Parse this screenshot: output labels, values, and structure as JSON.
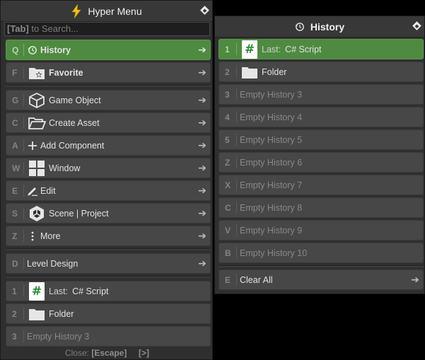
{
  "main_panel": {
    "title": "Hyper Menu",
    "search_placeholder_key": "[Tab]",
    "search_placeholder_text": " to Search...",
    "items": [
      {
        "key": "Q",
        "label": "History",
        "arrow": "➔"
      },
      {
        "key": "F",
        "label": "Favorite",
        "arrow": "➔"
      },
      {
        "key": "G",
        "label": "Game Object",
        "arrow": "➔"
      },
      {
        "key": "C",
        "label": "Create Asset",
        "arrow": "➔"
      },
      {
        "key": "A",
        "label": "Add Component",
        "arrow": "➔"
      },
      {
        "key": "W",
        "label": "Window",
        "arrow": "➔"
      },
      {
        "key": "E",
        "label": "Edit",
        "arrow": "➔"
      },
      {
        "key": "S",
        "label": "Scene | Project",
        "arrow": "➔"
      },
      {
        "key": "Z",
        "label": "More",
        "arrow": "➔"
      },
      {
        "key": "D",
        "label": "Level Design",
        "arrow": "➔"
      },
      {
        "key": "1",
        "prefix": "Last:",
        "label": "C# Script"
      },
      {
        "key": "2",
        "label": "Folder"
      },
      {
        "key": "3",
        "label": "Empty History 3"
      }
    ],
    "close_label": "Close:",
    "close_key": "[Escape]",
    "more_key": "[>]"
  },
  "history_panel": {
    "title": "History",
    "items": [
      {
        "key": "1",
        "prefix": "Last:",
        "label": "C# Script"
      },
      {
        "key": "2",
        "label": "Folder"
      },
      {
        "key": "3",
        "label": "Empty History 3"
      },
      {
        "key": "4",
        "label": "Empty History 4"
      },
      {
        "key": "5",
        "label": "Empty History 5"
      },
      {
        "key": "Z",
        "label": "Empty History 6"
      },
      {
        "key": "X",
        "label": "Empty History 7"
      },
      {
        "key": "C",
        "label": "Empty History 8"
      },
      {
        "key": "V",
        "label": "Empty History 9"
      },
      {
        "key": "B",
        "label": "Empty History 10"
      },
      {
        "key": "E",
        "label": "Clear All",
        "arrow": "➔"
      }
    ]
  },
  "colors": {
    "accent_selected": "#4f8a41",
    "row_bg": "#474747",
    "panel_bg": "#2f2f2f",
    "lightning": "#f3c21b"
  },
  "icons": {
    "title": "lightning-icon",
    "history": "history-clock-icon",
    "favorite": "folder-star-icon",
    "game_object": "cube-icon",
    "create_asset": "open-folder-icon",
    "add_component": "plus-icon",
    "window": "window-grid-icon",
    "edit": "pencil-icon",
    "scene": "unity-logo-icon",
    "more": "vertical-dots-icon",
    "script": "csharp-script-icon",
    "folder": "folder-icon"
  }
}
